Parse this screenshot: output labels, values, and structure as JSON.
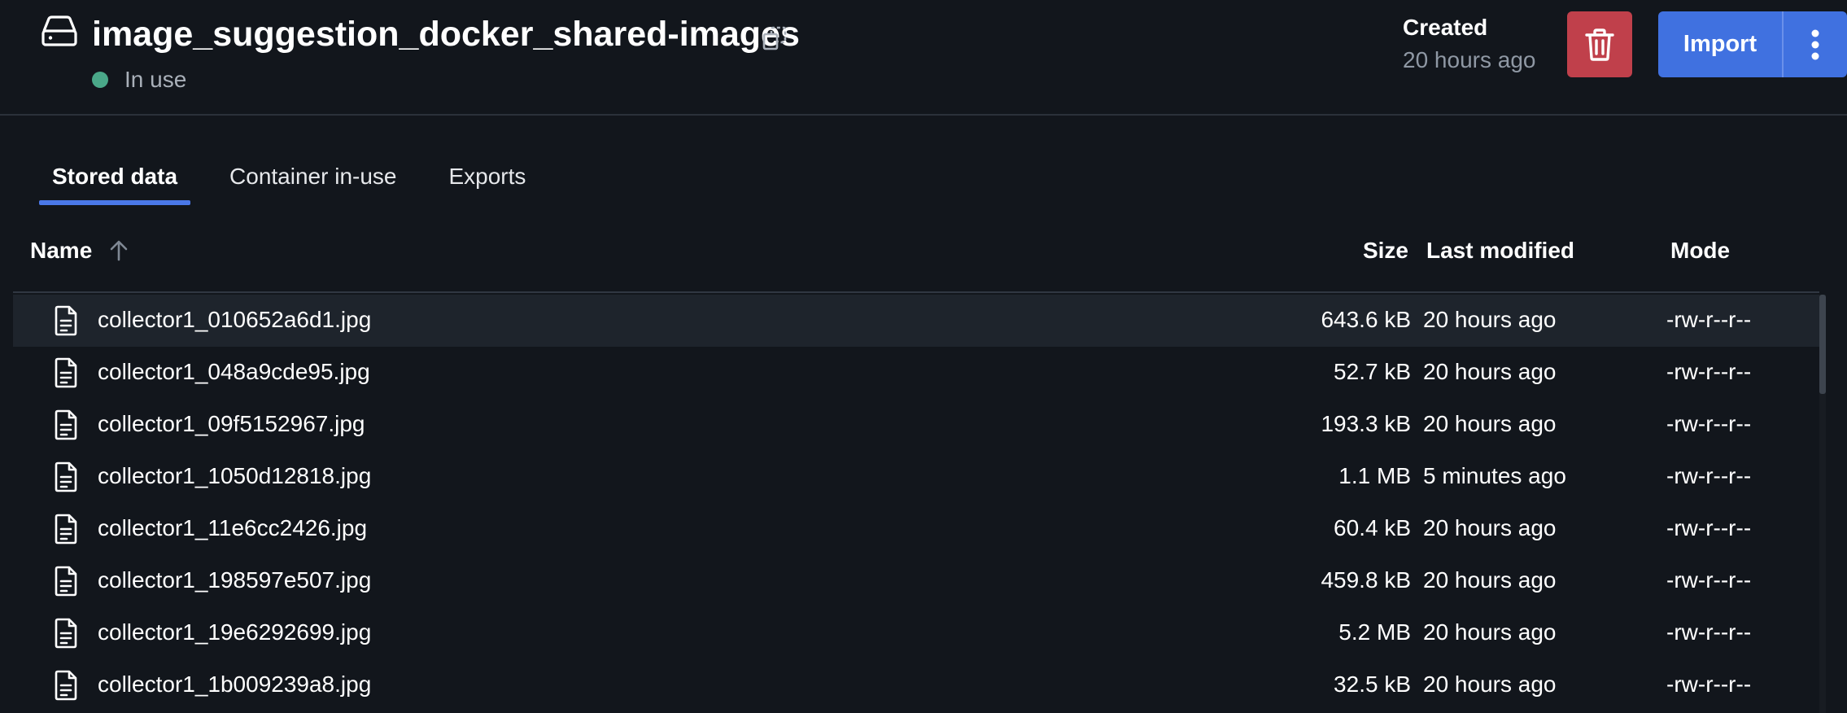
{
  "volume": {
    "title": "image_suggestion_docker_shared-images",
    "status": "In use",
    "status_color": "#4aa889",
    "created_label": "Created",
    "created_value": "20 hours ago",
    "icons": {
      "volume": "hard-drive-icon",
      "copy": "copy-icon",
      "delete": "trash-icon",
      "more": "more-vertical-icon"
    }
  },
  "actions": {
    "import_label": "Import",
    "delete_color": "#c0404b",
    "primary_color": "#4071e0"
  },
  "tabs": [
    {
      "label": "Stored data",
      "active": true
    },
    {
      "label": "Container in-use",
      "active": false
    },
    {
      "label": "Exports",
      "active": false
    }
  ],
  "table": {
    "columns": {
      "name": "Name",
      "size": "Size",
      "modified": "Last modified",
      "mode": "Mode"
    },
    "sort": {
      "column": "Name",
      "direction": "ascending"
    },
    "rows": [
      {
        "name": "collector1_010652a6d1.jpg",
        "size": "643.6 kB",
        "modified": "20 hours ago",
        "mode": "-rw-r--r--",
        "selected": true
      },
      {
        "name": "collector1_048a9cde95.jpg",
        "size": "52.7 kB",
        "modified": "20 hours ago",
        "mode": "-rw-r--r--"
      },
      {
        "name": "collector1_09f5152967.jpg",
        "size": "193.3 kB",
        "modified": "20 hours ago",
        "mode": "-rw-r--r--"
      },
      {
        "name": "collector1_1050d12818.jpg",
        "size": "1.1 MB",
        "modified": "5 minutes ago",
        "mode": "-rw-r--r--"
      },
      {
        "name": "collector1_11e6cc2426.jpg",
        "size": "60.4 kB",
        "modified": "20 hours ago",
        "mode": "-rw-r--r--"
      },
      {
        "name": "collector1_198597e507.jpg",
        "size": "459.8 kB",
        "modified": "20 hours ago",
        "mode": "-rw-r--r--"
      },
      {
        "name": "collector1_19e6292699.jpg",
        "size": "5.2 MB",
        "modified": "20 hours ago",
        "mode": "-rw-r--r--"
      },
      {
        "name": "collector1_1b009239a8.jpg",
        "size": "32.5 kB",
        "modified": "20 hours ago",
        "mode": "-rw-r--r--"
      }
    ]
  }
}
